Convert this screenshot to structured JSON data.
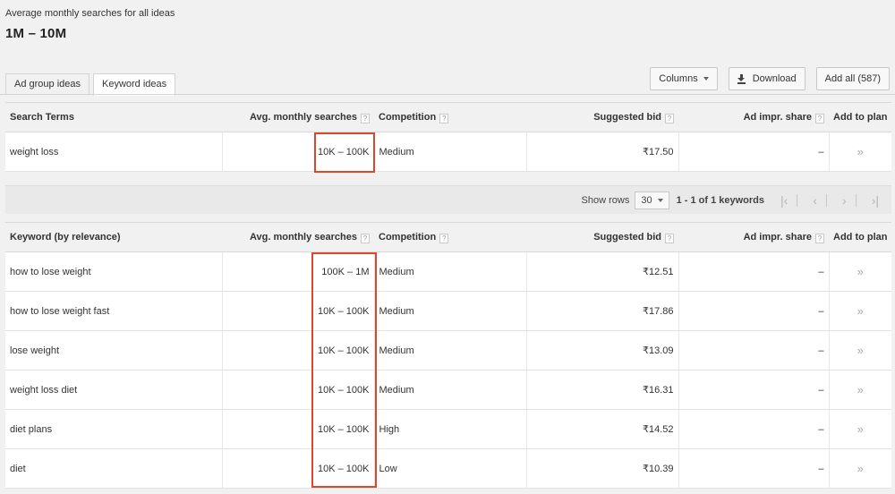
{
  "summary": {
    "label": "Average monthly searches for all ideas",
    "value": "1M – 10M"
  },
  "tabs": [
    {
      "label": "Ad group ideas"
    },
    {
      "label": "Keyword ideas"
    }
  ],
  "toolbar": {
    "columns_label": "Columns",
    "download_label": "Download",
    "add_all_label": "Add all (587)"
  },
  "search_terms": {
    "headers": {
      "term": "Search Terms",
      "avg": "Avg. monthly searches",
      "competition": "Competition",
      "bid": "Suggested bid",
      "impr": "Ad impr. share",
      "add": "Add to plan"
    },
    "help_glyph": "?",
    "rows": [
      {
        "term": "weight loss",
        "avg": "10K – 100K",
        "competition": "Medium",
        "bid": "₹17.50",
        "impr": "–",
        "add": "»"
      }
    ]
  },
  "pager": {
    "show_rows_label": "Show rows",
    "rows_value": "30",
    "range_text": "1 - 1 of 1 keywords",
    "first": "|‹",
    "prev": "‹",
    "next": "›",
    "last": "›|"
  },
  "keyword_ideas": {
    "headers": {
      "term": "Keyword (by relevance)",
      "avg": "Avg. monthly searches",
      "competition": "Competition",
      "bid": "Suggested bid",
      "impr": "Ad impr. share",
      "add": "Add to plan"
    },
    "rows": [
      {
        "term": "how to lose weight",
        "avg": "100K – 1M",
        "competition": "Medium",
        "bid": "₹12.51",
        "impr": "–",
        "add": "»"
      },
      {
        "term": "how to lose weight fast",
        "avg": "10K – 100K",
        "competition": "Medium",
        "bid": "₹17.86",
        "impr": "–",
        "add": "»"
      },
      {
        "term": "lose weight",
        "avg": "10K – 100K",
        "competition": "Medium",
        "bid": "₹13.09",
        "impr": "–",
        "add": "»"
      },
      {
        "term": "weight loss diet",
        "avg": "10K – 100K",
        "competition": "Medium",
        "bid": "₹16.31",
        "impr": "–",
        "add": "»"
      },
      {
        "term": "diet plans",
        "avg": "10K – 100K",
        "competition": "High",
        "bid": "₹14.52",
        "impr": "–",
        "add": "»"
      },
      {
        "term": "diet",
        "avg": "10K – 100K",
        "competition": "Low",
        "bid": "₹10.39",
        "impr": "–",
        "add": "»"
      }
    ]
  },
  "colors": {
    "highlight": "#d9482b"
  }
}
